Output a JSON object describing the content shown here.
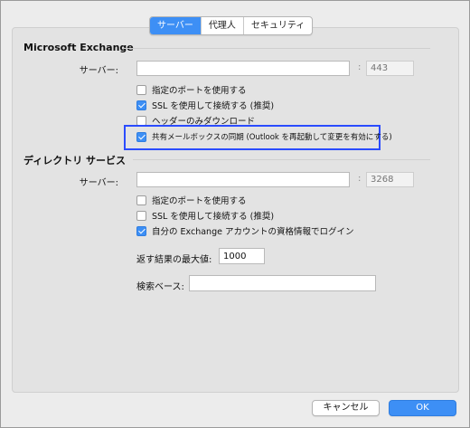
{
  "tabs": [
    {
      "label": "サーバー",
      "active": true
    },
    {
      "label": "代理人",
      "active": false
    },
    {
      "label": "セキュリティ",
      "active": false
    }
  ],
  "exchange": {
    "title": "Microsoft Exchange",
    "server_label": "サーバー:",
    "server_value": "",
    "port_placeholder": "443",
    "options": [
      {
        "label": "指定のポートを使用する",
        "checked": false
      },
      {
        "label": "SSL を使用して接続する (推奨)",
        "checked": true
      },
      {
        "label": "ヘッダーのみダウンロード",
        "checked": false
      },
      {
        "label": "共有メールボックスの同期 (Outlook を再起動して変更を有効にする)",
        "checked": true
      }
    ]
  },
  "directory": {
    "title": "ディレクトリ サービス",
    "server_label": "サーバー:",
    "server_value": "",
    "port_placeholder": "3268",
    "options": [
      {
        "label": "指定のポートを使用する",
        "checked": false
      },
      {
        "label": "SSL を使用して接続する (推奨)",
        "checked": false
      },
      {
        "label": "自分の Exchange アカウントの資格情報でログイン",
        "checked": true
      }
    ],
    "max_results_label": "返す結果の最大値:",
    "max_results_value": "1000",
    "search_base_label": "検索ベース:",
    "search_base_value": ""
  },
  "footer": {
    "cancel_label": "キャンセル",
    "ok_label": "OK"
  },
  "colors": {
    "accent": "#3d8ff5",
    "highlight_border": "#2b4cff"
  }
}
